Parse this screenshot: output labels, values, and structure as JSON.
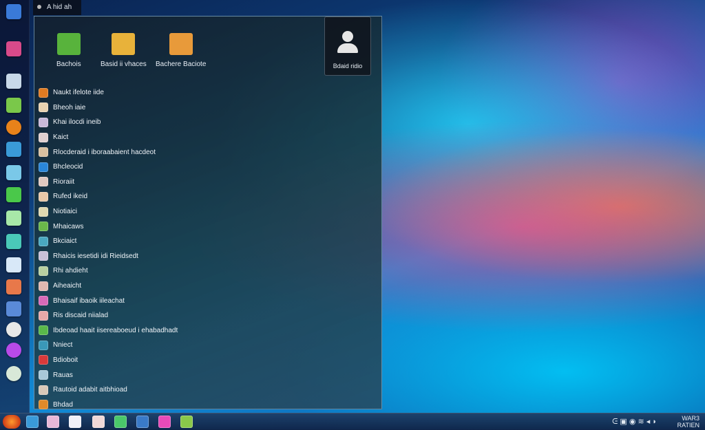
{
  "top_window": {
    "title": "A hid ah"
  },
  "places": [
    {
      "label": "Bachois",
      "icon": "folder-green-icon",
      "color": "#58b33c"
    },
    {
      "label": "Basid ii vhaces",
      "icon": "package-icon",
      "color": "#e8b23a"
    },
    {
      "label": "Bachere Baciote",
      "icon": "folder-orange-icon",
      "color": "#e89a3a"
    }
  ],
  "user": {
    "name": "Bdaid ridio"
  },
  "apps": [
    {
      "label": "Naukt ifelote iide",
      "icon": "app-orange-icon",
      "color": "#e07b22"
    },
    {
      "label": "Bheoh iaie",
      "icon": "app-doc-icon",
      "color": "#e8d2b0"
    },
    {
      "label": "Khai ilocdi ineib",
      "icon": "app-grid-icon",
      "color": "#c8b8d8"
    },
    {
      "label": "Kaict",
      "icon": "app-doc-icon",
      "color": "#e0d0d0"
    },
    {
      "label": "Rlocderaid i iboraabaient hacdeot",
      "icon": "app-grid-icon",
      "color": "#d8c0a0"
    },
    {
      "label": "Bhcleocid",
      "icon": "app-blue-icon",
      "color": "#2a86d8"
    },
    {
      "label": "Rioraiit",
      "icon": "app-doc-icon",
      "color": "#e0c8c0"
    },
    {
      "label": "Rufed ikeid",
      "icon": "app-doc-icon",
      "color": "#e8c8a8"
    },
    {
      "label": "Niotiaici",
      "icon": "app-doc-icon",
      "color": "#e0d8b0"
    },
    {
      "label": "Mhaicaws",
      "icon": "app-green-icon",
      "color": "#6ab84a"
    },
    {
      "label": "Bkciaict",
      "icon": "app-teal-icon",
      "color": "#4aa8c0"
    },
    {
      "label": "Rhaicis iesetidi idi Rieidsedt",
      "icon": "app-grid-icon",
      "color": "#c8c0d8"
    },
    {
      "label": "Rhi ahdieht",
      "icon": "app-grid-icon",
      "color": "#b8d0a0"
    },
    {
      "label": "Aiheaicht",
      "icon": "app-doc-icon",
      "color": "#e0b8b0"
    },
    {
      "label": "Bhaisaif ibaoik iileachat",
      "icon": "app-pink-icon",
      "color": "#d86ab8"
    },
    {
      "label": "Ris discaid niialad",
      "icon": "app-doc-icon",
      "color": "#e8a8a8"
    },
    {
      "label": "Ibdeoad haait iisereaboeud i ehabadhadt",
      "icon": "app-green-icon",
      "color": "#5ab84a"
    },
    {
      "label": "Nniect",
      "icon": "app-teal-icon",
      "color": "#3a98b8"
    },
    {
      "label": "Bdioboit",
      "icon": "app-red-icon",
      "color": "#d83a3a"
    },
    {
      "label": "Rauas",
      "icon": "app-grid-icon",
      "color": "#a8c8d8"
    },
    {
      "label": "Rautoid adabit aitbhioad",
      "icon": "app-doc-icon",
      "color": "#d8c8b8"
    },
    {
      "label": "Bhdad",
      "icon": "app-orange-icon",
      "color": "#e08a2a"
    }
  ],
  "dock_icons": [
    {
      "icon": "windows-logo-icon",
      "color": "#3a7ad8"
    },
    {
      "icon": "network-icon",
      "color": "#d84a8a"
    },
    {
      "icon": "calculator-icon",
      "color": "#c8d8e8"
    },
    {
      "icon": "photos-icon",
      "color": "#7ac84a"
    },
    {
      "icon": "firefox-icon",
      "color": "#e8821a"
    },
    {
      "icon": "control-panel-icon",
      "color": "#3a9ad8"
    },
    {
      "icon": "documents-icon",
      "color": "#7ac8e8"
    },
    {
      "icon": "games-icon",
      "color": "#4ac84a"
    },
    {
      "icon": "notepad-icon",
      "color": "#a8e8a8"
    },
    {
      "icon": "map-icon",
      "color": "#4ac8b8"
    },
    {
      "icon": "file-icon",
      "color": "#d8e8f8"
    },
    {
      "icon": "paint-icon",
      "color": "#e8784a"
    },
    {
      "icon": "tools-icon",
      "color": "#5a8ad8"
    },
    {
      "icon": "clock-icon",
      "color": "#e8e8e8"
    },
    {
      "icon": "media-icon",
      "color": "#b84ae8"
    },
    {
      "icon": "headset-icon",
      "color": "#d8e8d8"
    }
  ],
  "taskbar_icons": [
    {
      "icon": "explorer-icon",
      "color": "#3a9ad8"
    },
    {
      "icon": "settings-icon",
      "color": "#e8b8d8"
    },
    {
      "icon": "notes-icon",
      "color": "#f0f0f8"
    },
    {
      "icon": "document-icon",
      "color": "#f0d8d8"
    },
    {
      "icon": "store-icon",
      "color": "#4ac86a"
    },
    {
      "icon": "tiles-icon",
      "color": "#3a7ac8"
    },
    {
      "icon": "gallery-icon",
      "color": "#e84ab8"
    },
    {
      "icon": "paint-icon",
      "color": "#8ac84a"
    }
  ],
  "tray": {
    "glyphs": "ᕮ  ▣  ◉  ≋  ◂  ◗"
  },
  "clock": {
    "time": "WAR3",
    "date": "RATIEN"
  }
}
